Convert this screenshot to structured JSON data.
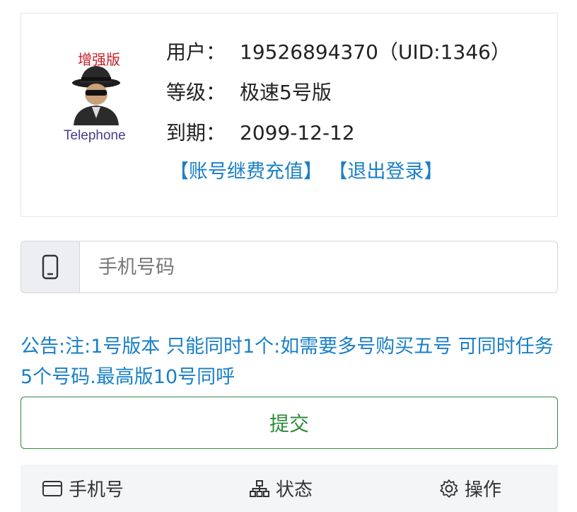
{
  "account": {
    "avatar_text_top": "增强版",
    "avatar_text_bottom": "Telephone",
    "user_label": "用户：",
    "user_value": "19526894370（UID:1346）",
    "level_label": "等级：",
    "level_value": "极速5号版",
    "expiry_label": "到期：",
    "expiry_value": "2099-12-12",
    "renew_link": "【账号继费充值】",
    "logout_link": "【退出登录】"
  },
  "form": {
    "phone_placeholder": "手机号码",
    "phone_icon": "mobile-phone-icon",
    "notice": "公告:注:1号版本 只能同时1个:如需要多号购买五号 可同时任务5个号码.最高版10号同呼",
    "submit_label": "提交"
  },
  "table": {
    "columns": [
      {
        "label": "手机号",
        "icon": "card-icon"
      },
      {
        "label": "状态",
        "icon": "sitemap-icon"
      },
      {
        "label": "操作",
        "icon": "gear-icon"
      }
    ]
  },
  "colors": {
    "link": "#1a7fc5",
    "submit": "#2e8b3e",
    "header_bg": "#f4f5f7"
  }
}
